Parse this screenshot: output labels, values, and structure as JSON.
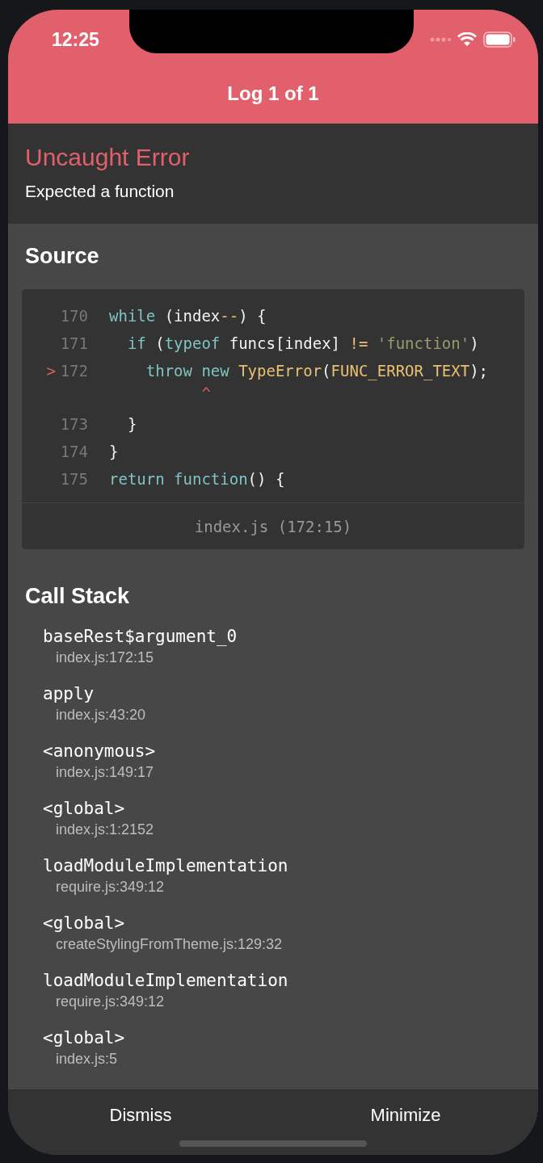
{
  "status_bar": {
    "time": "12:25"
  },
  "header": {
    "title": "Log 1 of 1"
  },
  "error": {
    "title": "Uncaught Error",
    "message": "Expected a function"
  },
  "source": {
    "heading": "Source",
    "lines": [
      {
        "kind": "code",
        "number": "170",
        "tokens": [
          {
            "kind": "keyword",
            "text": "while"
          },
          {
            "kind": "plain",
            "text": " (index"
          },
          {
            "kind": "operator",
            "text": "--"
          },
          {
            "kind": "plain",
            "text": ") {"
          }
        ]
      },
      {
        "kind": "code",
        "number": "171",
        "tokens": [
          {
            "kind": "keyword",
            "text": "  if"
          },
          {
            "kind": "plain",
            "text": " ("
          },
          {
            "kind": "keyword",
            "text": "typeof"
          },
          {
            "kind": "plain",
            "text": " funcs[index] "
          },
          {
            "kind": "operator",
            "text": "!="
          },
          {
            "kind": "string",
            "text": " 'function'"
          },
          {
            "kind": "plain",
            "text": ")"
          }
        ]
      },
      {
        "kind": "code",
        "number": "172",
        "marker": ">",
        "tokens": [
          {
            "kind": "keyword",
            "text": "    throw new"
          },
          {
            "kind": "operator",
            "text": " TypeError"
          },
          {
            "kind": "plain",
            "text": "("
          },
          {
            "kind": "operator",
            "text": "FUNC_ERROR_TEXT"
          },
          {
            "kind": "plain",
            "text": ");"
          }
        ]
      },
      {
        "kind": "pointer",
        "text": "          ^"
      },
      {
        "kind": "code",
        "number": "173",
        "tokens": [
          {
            "kind": "plain",
            "text": "  }"
          }
        ]
      },
      {
        "kind": "code",
        "number": "174",
        "tokens": [
          {
            "kind": "plain",
            "text": "}"
          }
        ]
      },
      {
        "kind": "code",
        "number": "175",
        "tokens": [
          {
            "kind": "keyword",
            "text": "return function"
          },
          {
            "kind": "plain",
            "text": "() {"
          }
        ]
      }
    ],
    "location": "index.js (172:15)"
  },
  "call_stack": {
    "heading": "Call Stack",
    "frames": [
      {
        "name": "baseRest$argument_0",
        "location": "index.js:172:15"
      },
      {
        "name": "apply",
        "location": "index.js:43:20"
      },
      {
        "name": "<anonymous>",
        "location": "index.js:149:17"
      },
      {
        "name": "<global>",
        "location": "index.js:1:2152"
      },
      {
        "name": "loadModuleImplementation",
        "location": "require.js:349:12"
      },
      {
        "name": "<global>",
        "location": "createStylingFromTheme.js:129:32"
      },
      {
        "name": "loadModuleImplementation",
        "location": "require.js:349:12"
      },
      {
        "name": "<global>",
        "location": "index.js:5"
      }
    ]
  },
  "buttons": [
    "Dismiss",
    "Minimize"
  ]
}
